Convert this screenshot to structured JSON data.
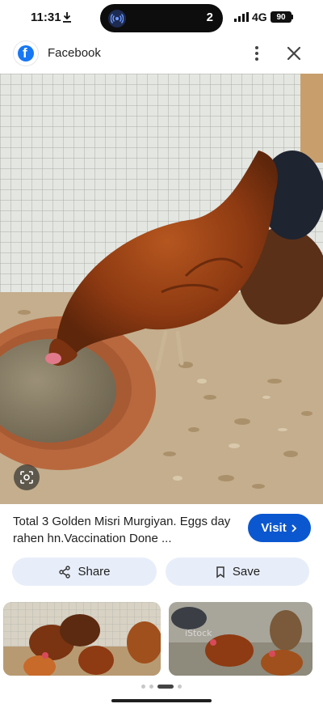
{
  "status_bar": {
    "time": "11:31",
    "notification_count": "2",
    "network": "4G",
    "battery": "90"
  },
  "header": {
    "source_name": "Facebook",
    "icons": [
      "facebook-logo-icon",
      "more-vert-icon",
      "close-icon"
    ]
  },
  "image": {
    "lens_icon": "google-lens-icon"
  },
  "result": {
    "caption": "Total 3 Golden Misri Murgiyan. Eggs day rahen hn.Vaccination Done ...",
    "visit_label": "Visit",
    "share_label": "Share",
    "save_label": "Save"
  },
  "colors": {
    "visit_button": "#0b57d0",
    "action_button_bg": "#e8eef9",
    "facebook_blue": "#1877f2"
  },
  "related": {
    "thumb2_watermark": "iStock"
  },
  "pager": {
    "pages": 4,
    "active_index": 2
  }
}
